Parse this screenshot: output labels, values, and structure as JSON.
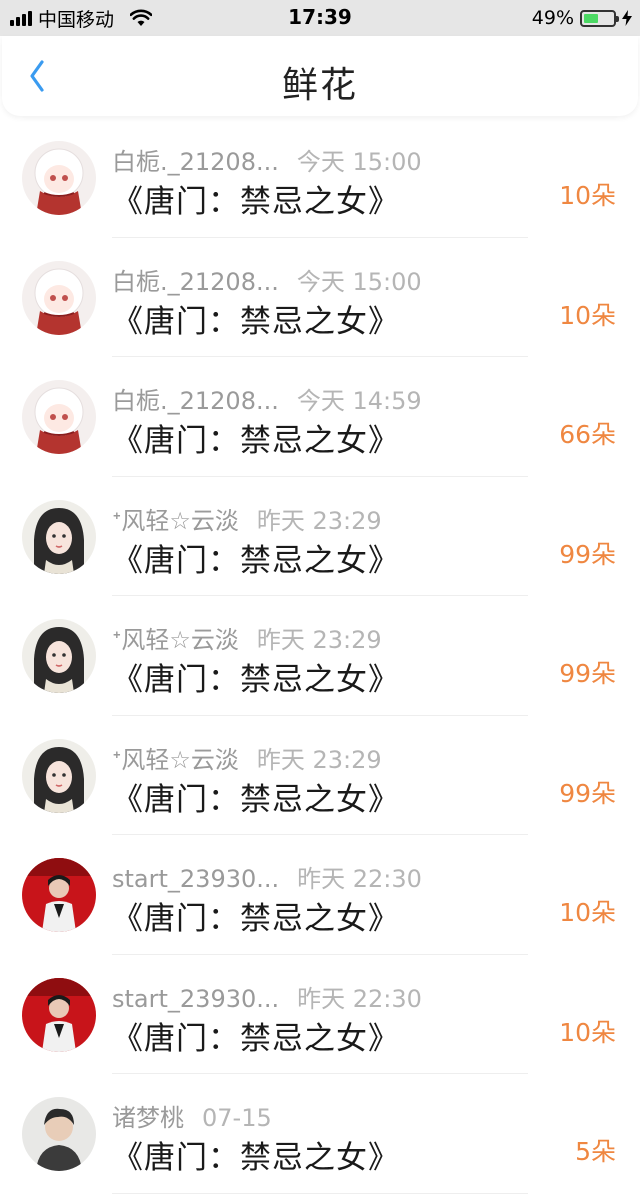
{
  "status_bar": {
    "carrier": "中国移动",
    "time": "17:39",
    "battery": "49%",
    "battery_level": 0.49,
    "icons": [
      "signal-icon",
      "wifi-icon",
      "battery-icon",
      "charging-icon"
    ]
  },
  "header": {
    "title": "鲜花",
    "back_icon": "chevron-left-icon"
  },
  "colors": {
    "accent": "#ef8741",
    "back": "#3a9bf0",
    "battery_fill": "#4cd964"
  },
  "gifts": [
    {
      "user": "白栀._21208...",
      "time": "今天 15:00",
      "book": "《唐门：禁忌之女》",
      "amount": "10朵",
      "avatar": "white-haired-girl-avatar"
    },
    {
      "user": "白栀._21208...",
      "time": "今天 15:00",
      "book": "《唐门：禁忌之女》",
      "amount": "10朵",
      "avatar": "white-haired-girl-avatar"
    },
    {
      "user": "白栀._21208...",
      "time": "今天 14:59",
      "book": "《唐门：禁忌之女》",
      "amount": "66朵",
      "avatar": "white-haired-girl-avatar"
    },
    {
      "user": "ᕀ风轻☆云淡",
      "time": "昨天 23:29",
      "book": "《唐门：禁忌之女》",
      "amount": "99朵",
      "avatar": "dark-haired-girl-avatar"
    },
    {
      "user": "ᕀ风轻☆云淡",
      "time": "昨天 23:29",
      "book": "《唐门：禁忌之女》",
      "amount": "99朵",
      "avatar": "dark-haired-girl-avatar"
    },
    {
      "user": "ᕀ风轻☆云淡",
      "time": "昨天 23:29",
      "book": "《唐门：禁忌之女》",
      "amount": "99朵",
      "avatar": "dark-haired-girl-avatar"
    },
    {
      "user": "start_23930...",
      "time": "昨天 22:30",
      "book": "《唐门：禁忌之女》",
      "amount": "10朵",
      "avatar": "red-background-person-avatar"
    },
    {
      "user": "start_23930...",
      "time": "昨天 22:30",
      "book": "《唐门：禁忌之女》",
      "amount": "10朵",
      "avatar": "red-background-person-avatar"
    },
    {
      "user": "诸梦桃",
      "time": "07-15",
      "book": "《唐门：禁忌之女》",
      "amount": "5朵",
      "avatar": "boy-avatar"
    }
  ]
}
